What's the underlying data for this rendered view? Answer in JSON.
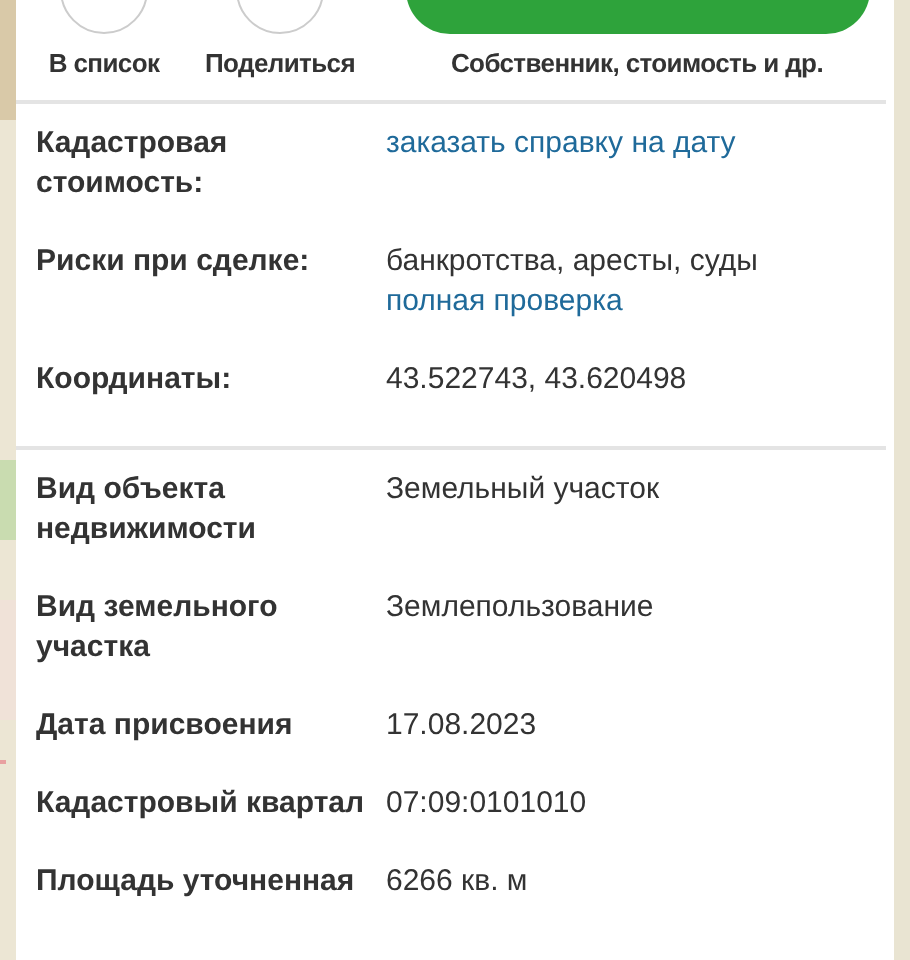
{
  "actions": [
    {
      "label": "В список"
    },
    {
      "label": "Поделиться"
    }
  ],
  "documents_button": {
    "caption": "Собственник, стоимость и др."
  },
  "sections": [
    {
      "rows": [
        {
          "label": "Кадастровая стоимость:",
          "values": [
            {
              "text": "заказать справку на дату",
              "kind": "link"
            }
          ]
        },
        {
          "label": "Риски при сделке:",
          "values": [
            {
              "text": "банкротства, аресты, суды",
              "kind": "text"
            },
            {
              "text": "полная проверка",
              "kind": "link"
            }
          ]
        },
        {
          "label": "Координаты:",
          "values": [
            {
              "text": "43.522743, 43.620498",
              "kind": "text"
            }
          ]
        }
      ]
    },
    {
      "rows": [
        {
          "label": "Вид объекта недвижимости",
          "values": [
            {
              "text": "Земельный участок",
              "kind": "text"
            }
          ]
        },
        {
          "label": "Вид земельного участка",
          "values": [
            {
              "text": "Землепользование",
              "kind": "text"
            }
          ]
        },
        {
          "label": "Дата присвоения",
          "values": [
            {
              "text": "17.08.2023",
              "kind": "text"
            }
          ]
        },
        {
          "label": "Кадастровый квартал",
          "values": [
            {
              "text": "07:09:0101010",
              "kind": "text"
            }
          ]
        },
        {
          "label": "Площадь уточненная",
          "values": [
            {
              "text": "6266 кв. м",
              "kind": "text"
            }
          ]
        }
      ]
    }
  ]
}
